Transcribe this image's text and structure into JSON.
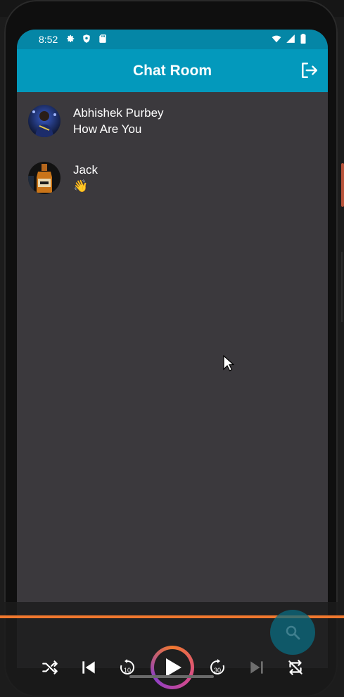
{
  "status_bar": {
    "time": "8:52",
    "icons_left": [
      "gear-icon",
      "shield-icon",
      "sd-card-icon"
    ],
    "icons_right": [
      "wifi-icon",
      "signal-icon",
      "battery-icon"
    ],
    "color": "#0586a6"
  },
  "app_bar": {
    "title": "Chat Room",
    "color": "#0399bc",
    "action_icon": "logout-icon"
  },
  "chats": [
    {
      "name": "Abhishek Purbey",
      "last_message": "How Are You"
    },
    {
      "name": "Jack",
      "last_message": "👋"
    }
  ],
  "media_controls": {
    "icons": [
      "shuffle-icon",
      "skip-previous-icon",
      "replay-10-icon",
      "play-icon",
      "forward-30-icon",
      "skip-next-icon",
      "repeat-icon"
    ],
    "replay_label": "10",
    "forward_label": "30",
    "accent": "#f0782e"
  },
  "fab": {
    "icon": "search-icon"
  },
  "colors": {
    "screen_bg": "#3b393d"
  }
}
